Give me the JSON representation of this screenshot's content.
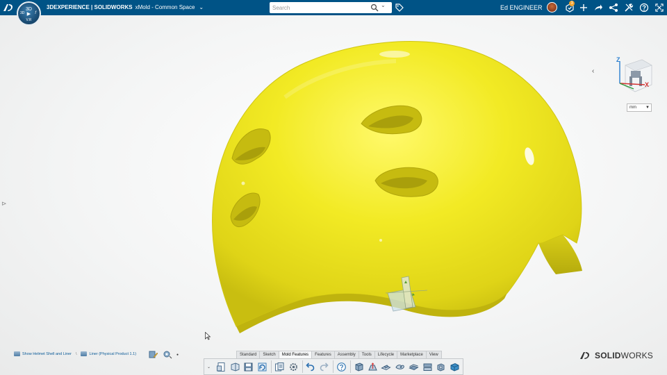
{
  "header": {
    "compass": {
      "top": "3D",
      "left": "3D",
      "right": "f",
      "version": "V.R"
    },
    "brand": "3DEXPERIENCE | SOLIDWORKS",
    "app": "xMold - Common Space",
    "search_placeholder": "Search",
    "user_name": "Ed ENGINEER",
    "notification_count": "3",
    "icons": [
      "tag-icon",
      "notifications-icon",
      "add-icon",
      "share-icon",
      "network-icon",
      "tools-icon",
      "help-icon",
      "fullscreen-icon"
    ]
  },
  "viewport": {
    "units": "mm",
    "triad": {
      "z": "Z",
      "x": "X"
    },
    "model_color": "#f2ea24"
  },
  "breadcrumb": [
    {
      "label": "Show Helmet Shell and Liner"
    },
    {
      "label": "Liner (Physical Product 1.1)"
    }
  ],
  "command_manager": {
    "tabs": [
      "Standard",
      "Sketch",
      "Mold Features",
      "Features",
      "Assembly",
      "Tools",
      "Lifecycle",
      "Marketplace",
      "View"
    ],
    "active_tab": "Mold Features"
  },
  "brand_logo": {
    "prefix": "3DS",
    "bold": "SOLID",
    "rest": "WORKS"
  }
}
